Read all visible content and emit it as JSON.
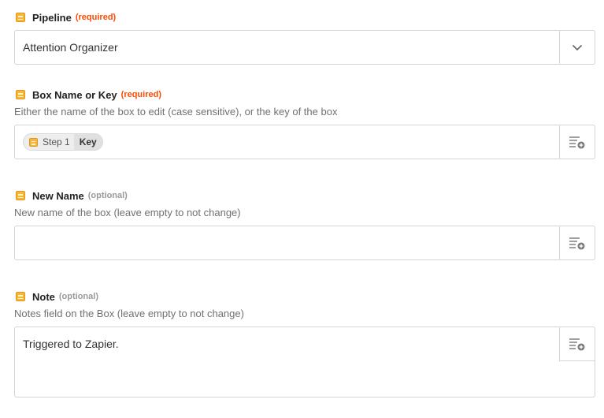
{
  "fields": [
    {
      "label": "Pipeline",
      "tag": "(required)",
      "value": "Attention Organizer"
    },
    {
      "label": "Box Name or Key",
      "tag": "(required)",
      "help": "Either the name of the box to edit (case sensitive), or the key of the box",
      "pill": {
        "step": "Step 1",
        "key": "Key"
      }
    },
    {
      "label": "New Name",
      "tag": "(optional)",
      "help": "New name of the box (leave empty to not change)",
      "value": ""
    },
    {
      "label": "Note",
      "tag": "(optional)",
      "help": "Notes field on the Box (leave empty to not change)",
      "value": "Triggered to Zapier."
    }
  ],
  "icons": {
    "field_icon": "streak-app-icon",
    "dropdown": "chevron-down-icon",
    "insert": "insert-data-icon"
  },
  "colors": {
    "required": "#ff4a00",
    "optional": "#9a9a9a",
    "app_icon": "#f5b63a"
  }
}
